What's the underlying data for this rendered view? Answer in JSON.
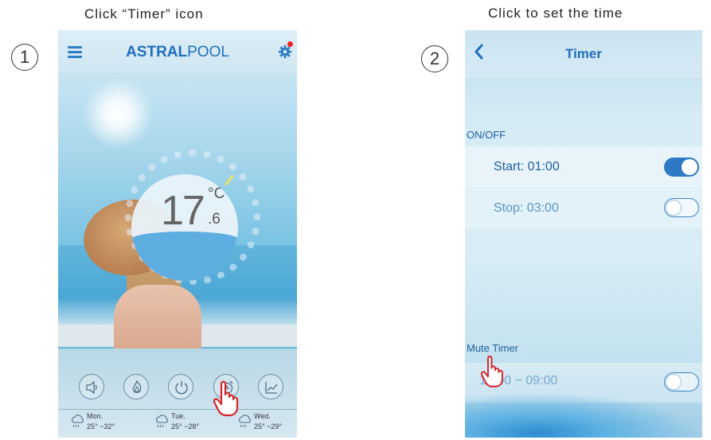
{
  "step1": {
    "number": "1",
    "caption": "Click “Timer” icon",
    "header": {
      "brand_bold": "ASTRAL",
      "brand_regular": "POOL"
    },
    "temperature": {
      "whole": "17",
      "unit": "°C",
      "decimal": ".6"
    },
    "controls": [
      "speaker-icon",
      "flame-icon",
      "power-icon",
      "alarm-clock-icon",
      "chart-icon"
    ],
    "weather": [
      {
        "day": "Mon.",
        "range": "25° ~32°"
      },
      {
        "day": "Tue.",
        "range": "25° ~28°"
      },
      {
        "day": "Wed.",
        "range": "25° ~29°"
      }
    ]
  },
  "step2": {
    "number": "2",
    "caption": "Click  to set the time",
    "header": {
      "title": "Timer"
    },
    "onoff": {
      "label": "ON/OFF",
      "start": {
        "text": "Start: 01:00",
        "enabled": true
      },
      "stop": {
        "text": "Stop: 03:00",
        "enabled": false
      }
    },
    "mute": {
      "label": "Mute Timer",
      "range": {
        "text": "14:00 ~ 09:00",
        "enabled": false
      }
    }
  },
  "colors": {
    "brand_blue": "#1f6fbd",
    "toggle_on": "#2f78c4",
    "pointer_red": "#d4262b"
  }
}
